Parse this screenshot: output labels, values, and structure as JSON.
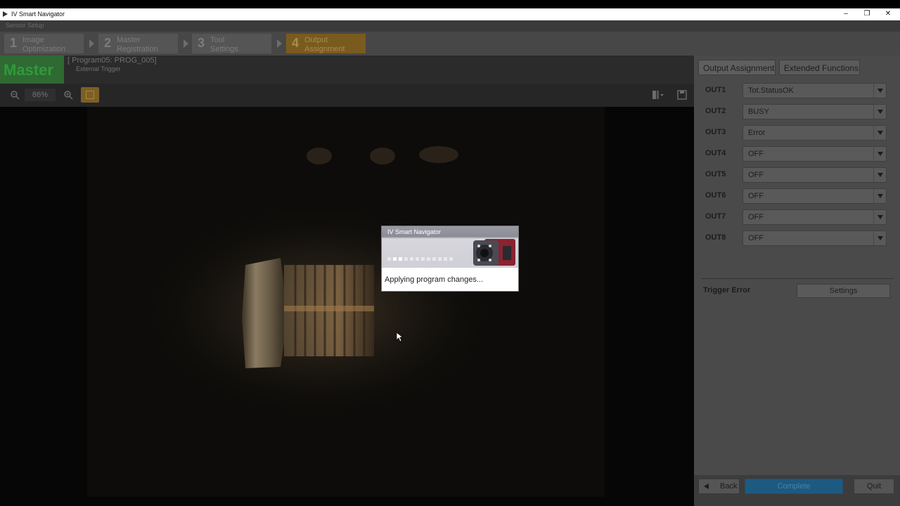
{
  "window": {
    "title": "IV Smart Navigator",
    "minimize": "–",
    "restore": "❐",
    "close": "✕"
  },
  "header": {
    "section": "Sensor Setup",
    "steps": [
      {
        "num": "1",
        "label_line1": "Image",
        "label_line2": "Optimization"
      },
      {
        "num": "2",
        "label_line1": "Master",
        "label_line2": "Registration"
      },
      {
        "num": "3",
        "label_line1": "Tool",
        "label_line2": "Settings"
      },
      {
        "num": "4",
        "label_line1": "Output",
        "label_line2": "Assignment"
      }
    ]
  },
  "image_panel": {
    "mode_badge": "Master",
    "program": "[ Program05: PROG_005]",
    "trigger": "External Trigger",
    "zoom": "86%"
  },
  "right_panel": {
    "tabs": [
      "Output Assignment",
      "Extended Functions"
    ],
    "outputs": [
      {
        "label": "OUT1",
        "value": "Tot.StatusOK"
      },
      {
        "label": "OUT2",
        "value": "BUSY"
      },
      {
        "label": "OUT3",
        "value": "Error"
      },
      {
        "label": "OUT4",
        "value": "OFF"
      },
      {
        "label": "OUT5",
        "value": "OFF"
      },
      {
        "label": "OUT6",
        "value": "OFF"
      },
      {
        "label": "OUT7",
        "value": "OFF"
      },
      {
        "label": "OUT8",
        "value": "OFF"
      }
    ],
    "trigger_error_label": "Trigger Error",
    "settings_button": "Settings",
    "back_button": "Back",
    "complete_button": "Complete",
    "quit_button": "Quit"
  },
  "dialog": {
    "title": "IV Smart Navigator",
    "message": "Applying program changes..."
  },
  "colors": {
    "master_green": "#2e6a31",
    "active_step": "#7a5b1e",
    "complete_blue": "#1d5a82"
  }
}
